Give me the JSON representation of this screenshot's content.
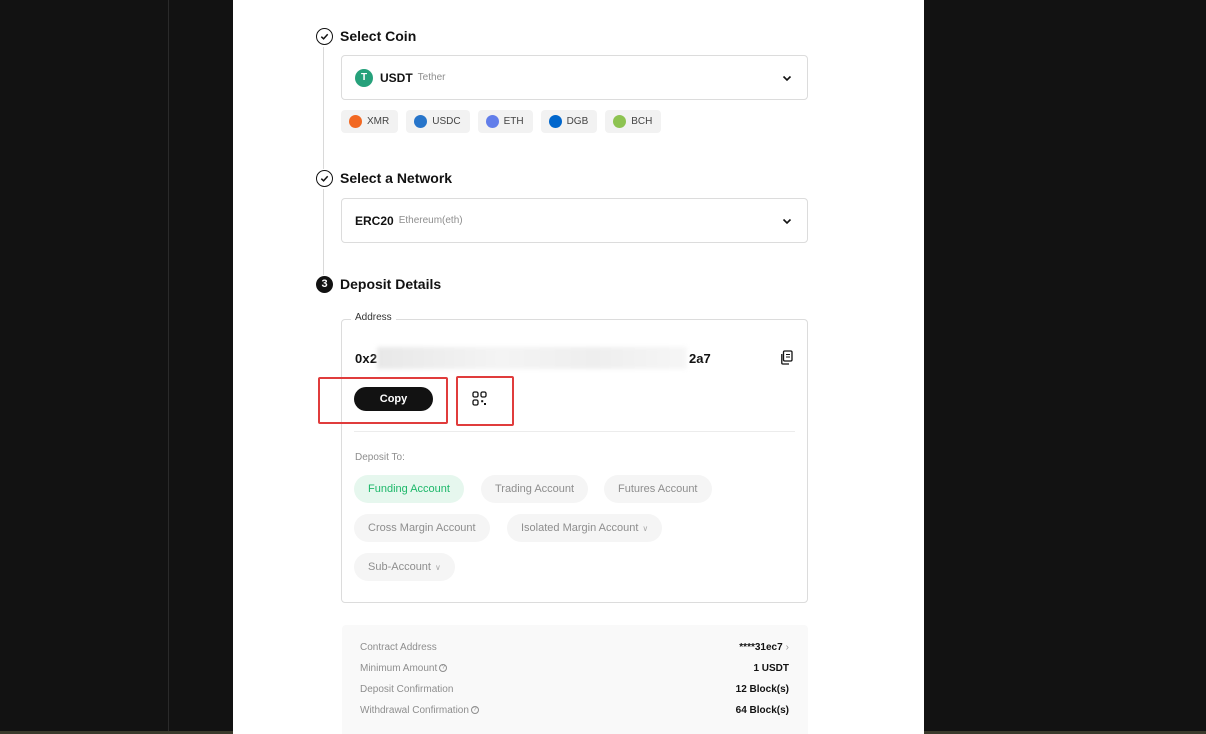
{
  "steps": {
    "coin": {
      "title": "Select Coin"
    },
    "network": {
      "title": "Select a Network"
    },
    "details": {
      "number": "3",
      "title": "Deposit Details"
    }
  },
  "coin_select": {
    "symbol": "USDT",
    "name": "Tether",
    "logo_glyph": "T"
  },
  "coin_chips": [
    {
      "label": "XMR",
      "color": "#f26822"
    },
    {
      "label": "USDC",
      "color": "#2775ca"
    },
    {
      "label": "ETH",
      "color": "#627eea"
    },
    {
      "label": "DGB",
      "color": "#0066cc"
    },
    {
      "label": "BCH",
      "color": "#8dc351"
    }
  ],
  "network_select": {
    "code": "ERC20",
    "name": "Ethereum(eth)"
  },
  "deposit": {
    "address_label": "Address",
    "address_prefix": "0x2",
    "address_suffix": "2a7",
    "copy_label": "Copy",
    "deposit_to_label": "Deposit To:",
    "accounts": [
      {
        "label": "Funding Account",
        "active": true
      },
      {
        "label": "Trading Account",
        "active": false
      },
      {
        "label": "Futures Account",
        "active": false
      },
      {
        "label": "Cross Margin Account",
        "active": false
      },
      {
        "label": "Isolated Margin Account",
        "active": false,
        "dropdown": true
      },
      {
        "label": "Sub-Account",
        "active": false,
        "dropdown": true
      }
    ]
  },
  "info": {
    "contract_label": "Contract Address",
    "contract_value": "****31ec7",
    "min_label": "Minimum Amount",
    "min_value": "1 USDT",
    "dep_conf_label": "Deposit Confirmation",
    "dep_conf_value": "12 Block(s)",
    "wd_conf_label": "Withdrawal Confirmation",
    "wd_conf_value": "64 Block(s)"
  },
  "colors": {
    "accent_green": "#1db86a",
    "highlight_red": "#e03c3c",
    "tether": "#26a17b"
  }
}
